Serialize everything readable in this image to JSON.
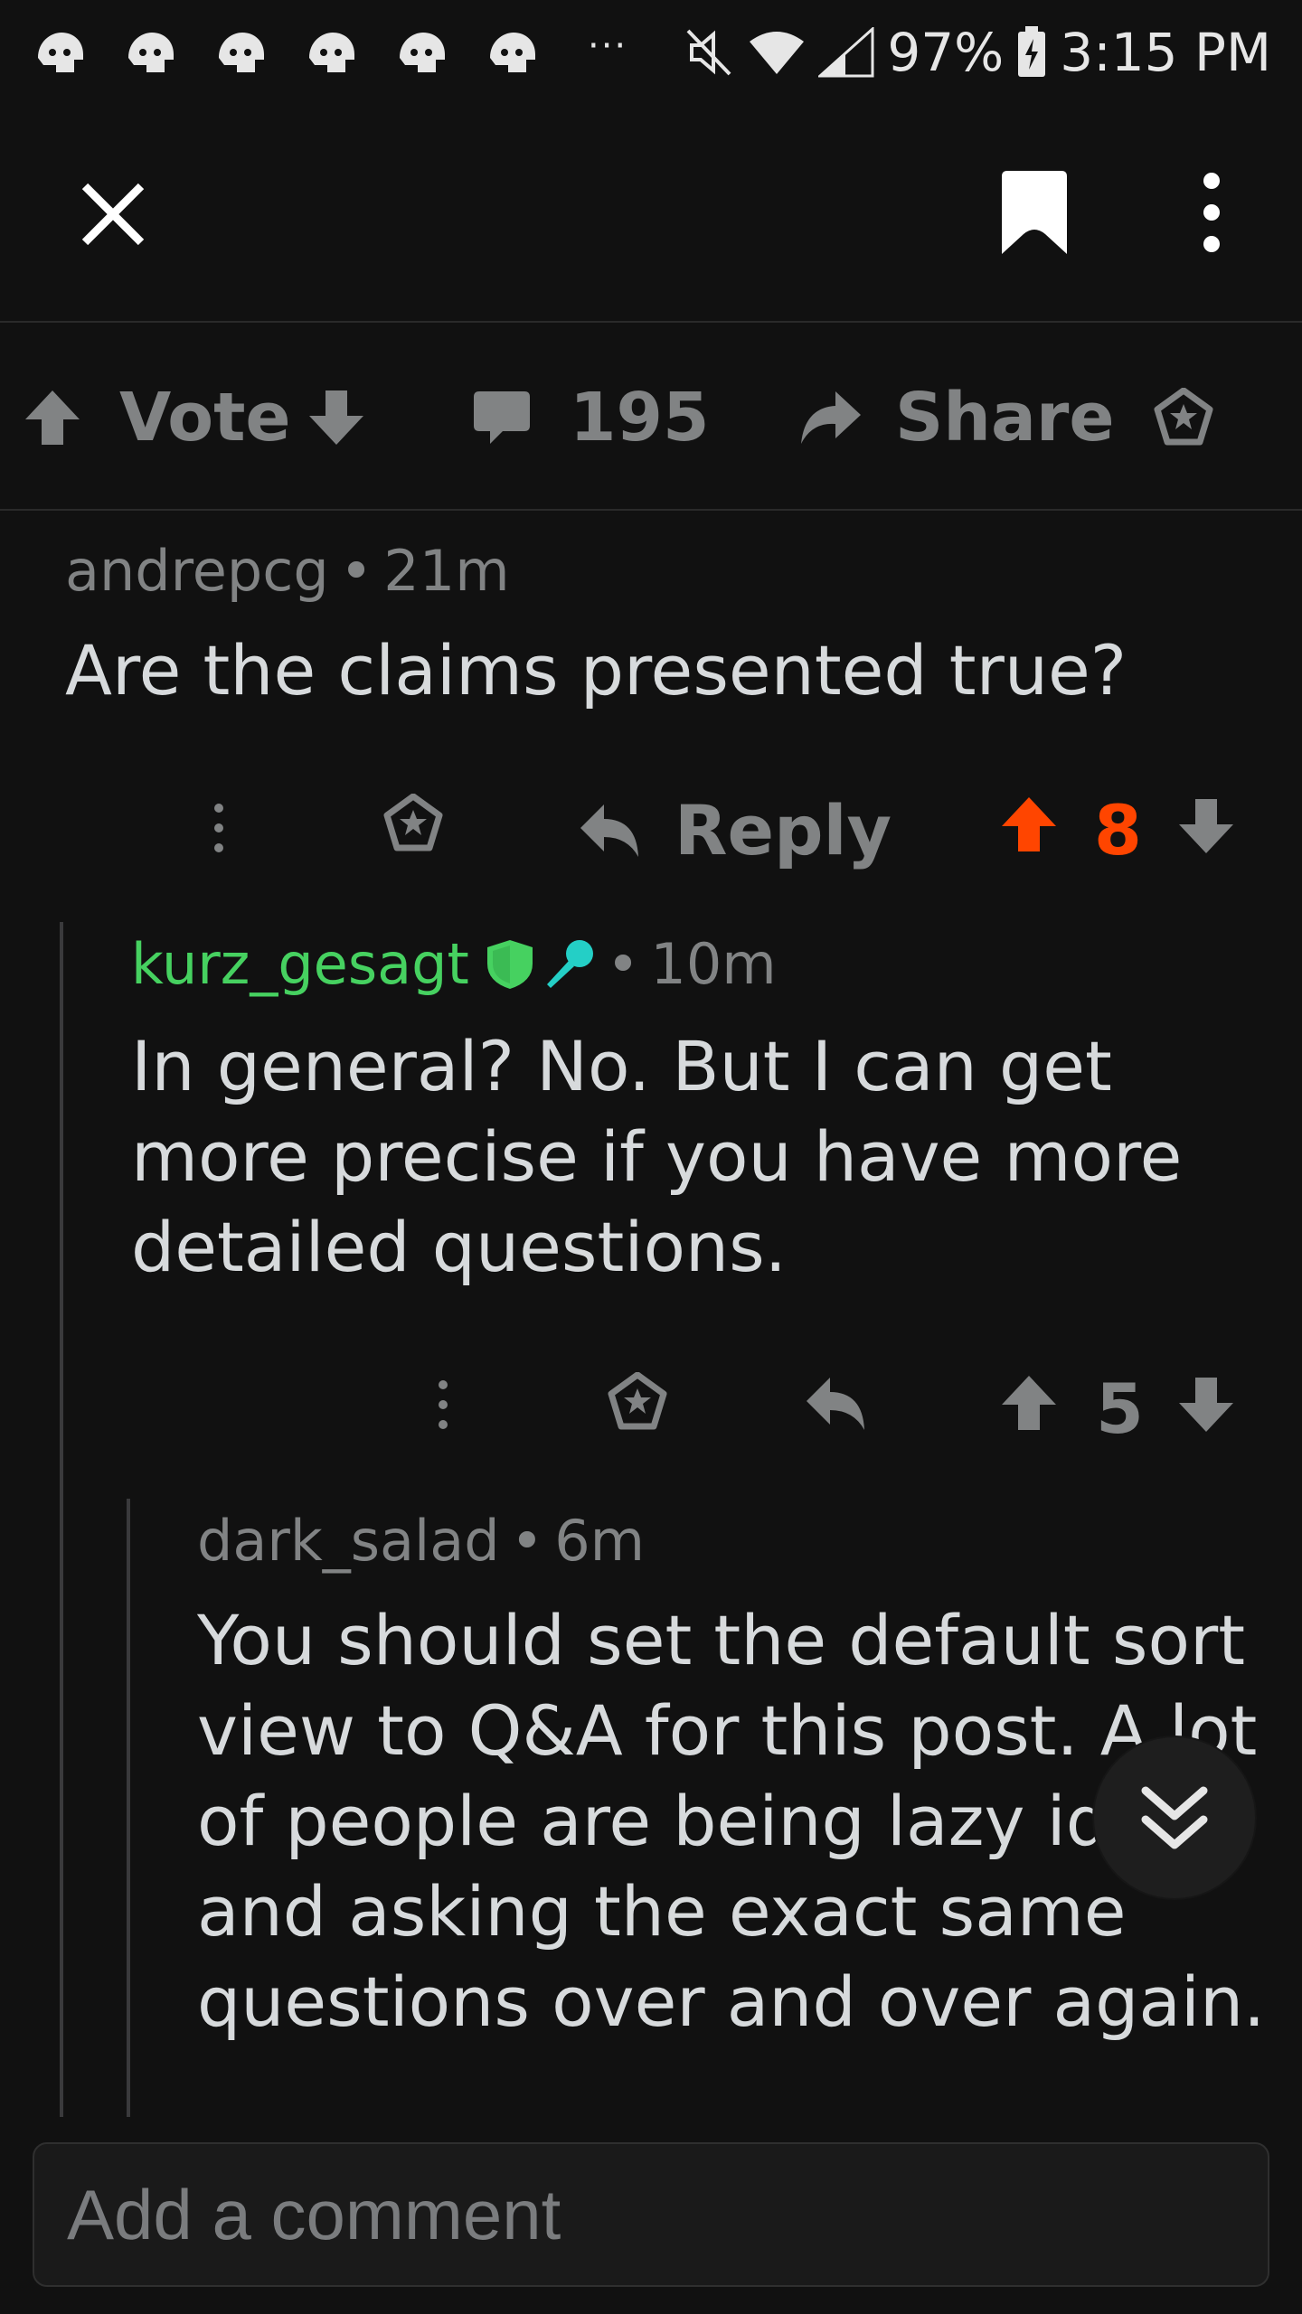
{
  "status_bar": {
    "battery": "97%",
    "time": "3:15 PM",
    "more": "···",
    "notification_icons": [
      "reddit-icon",
      "reddit-icon",
      "reddit-icon",
      "reddit-icon",
      "reddit-icon",
      "reddit-icon"
    ]
  },
  "action_bar": {
    "vote_label": "Vote",
    "comment_count": "195",
    "share_label": "Share"
  },
  "comments": [
    {
      "author": "andrepcg",
      "age": "21m",
      "body": "Are the claims presented true?",
      "reply_label": "Reply",
      "score": "8",
      "upvoted": true
    },
    {
      "author": "kurz_gesagt",
      "age": "10m",
      "body": "In general? No. But I can get more precise if you have more detailed questions.",
      "score": "5",
      "author_color": "#46d160"
    },
    {
      "author": "dark_salad",
      "age": "6m",
      "body": "You should set the default sort view to Q&A for this post. A lot of people are being lazy idiots and asking the exact same questions over and over again."
    }
  ],
  "comment_input": {
    "placeholder": "Add a comment"
  },
  "colors": {
    "background": "#111111",
    "upvote_active": "#ff4500",
    "mod_green": "#46d160",
    "ama_teal": "#24cfc6",
    "muted": "#818384"
  }
}
